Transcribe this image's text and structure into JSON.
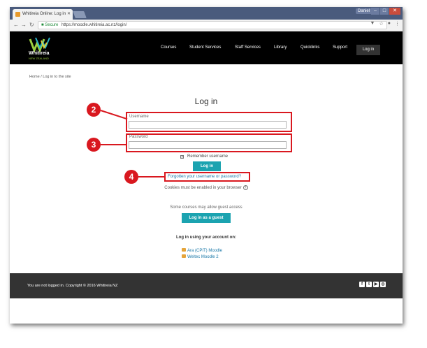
{
  "browser": {
    "tab_title": "Whitireia Online: Log in",
    "user_badge": "Daniel",
    "url": "https://moodle.whitireia.ac.nz/login/",
    "secure_label": "Secure"
  },
  "site": {
    "logo_text": "Whitireia",
    "logo_subtext": "NEW ZEALAND",
    "nav": [
      "Courses",
      "Student Services",
      "Staff Services",
      "Library",
      "Quicklinks",
      "Support"
    ],
    "login_label": "Log in"
  },
  "breadcrumb": "Home  /  Log in to the site",
  "login_form": {
    "title": "Log in",
    "username_label": "Username",
    "username_value": "",
    "password_label": "Password",
    "password_value": "",
    "remember_label": "Remember username",
    "remember_checked": true,
    "submit_label": "Log in",
    "forgot_link": "Forgotten your username or password?",
    "cookies_note": "Cookies must be enabled in your browser",
    "guest_note": "Some courses may allow guest access",
    "guest_button": "Log in as a guest",
    "using_title": "Log in using your account on:",
    "providers": [
      "Ara (CPIT) Moodle",
      "Weltec Moodle 2"
    ]
  },
  "footer": {
    "text": "You are not logged in.   Copyright © 2016 Whitireia NZ",
    "social": [
      "facebook-icon",
      "twitter-icon",
      "youtube-icon",
      "instagram-icon"
    ]
  },
  "markers": [
    "2",
    "3",
    "4"
  ],
  "colors": {
    "accent": "#1ba3b0",
    "highlight": "#d9181f",
    "header": "#000000",
    "footer": "#333333"
  }
}
